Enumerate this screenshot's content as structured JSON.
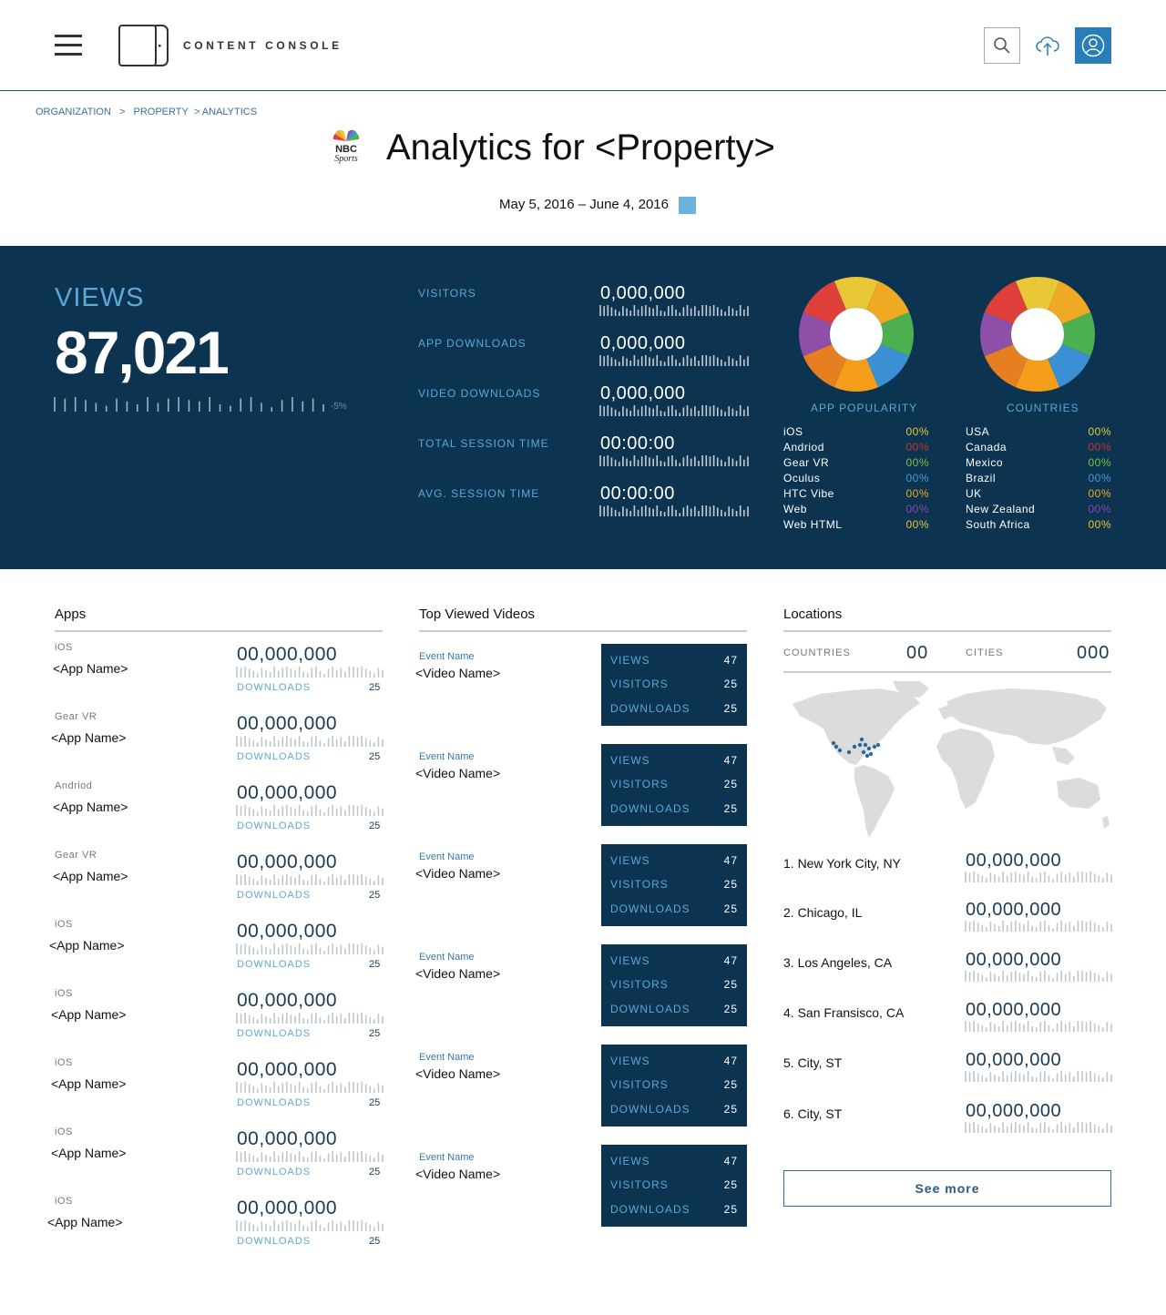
{
  "header": {
    "brand": "CONTENT CONSOLE"
  },
  "breadcrumb": [
    "ORGANIZATION",
    ">",
    "PROPERTY",
    "> ANALYTICS"
  ],
  "page": {
    "logo_text": "NBC Sports",
    "title": "Analytics for <Property>",
    "date_range": "May 5, 2016 – June 4, 2016"
  },
  "colors": {
    "panel": "#0c3350",
    "accent": "#5da8d6",
    "button": "#2a7eb8"
  },
  "views": {
    "label": "VIEWS",
    "value": "87,021",
    "change": "-5%"
  },
  "metrics": [
    {
      "label": "VISITORS",
      "value": "0,000,000"
    },
    {
      "label": "APP DOWNLOADS",
      "value": "0,000,000"
    },
    {
      "label": "VIDEO DOWNLOADS",
      "value": "0,000,000"
    },
    {
      "label": "TOTAL SESSION TIME",
      "value": "00:00:00"
    },
    {
      "label": "AVG. SESSION TIME",
      "value": "00:00:00"
    }
  ],
  "donut_colors": [
    "#e8c837",
    "#f0a922",
    "#4caf50",
    "#3b8fd3",
    "#f59e1c",
    "#e67e22",
    "#8e4fa8",
    "#e0403b"
  ],
  "app_popularity": {
    "title": "APP POPULARITY",
    "rows": [
      {
        "name": "iOS",
        "pct": "00%",
        "color": "#e8c837"
      },
      {
        "name": "Andriod",
        "pct": "00%",
        "color": "#c0392b"
      },
      {
        "name": "Gear VR",
        "pct": "00%",
        "color": "#7cc242"
      },
      {
        "name": "Oculus",
        "pct": "00%",
        "color": "#4a9ad8"
      },
      {
        "name": "HTC Vibe",
        "pct": "00%",
        "color": "#f0a922"
      },
      {
        "name": "Web",
        "pct": "00%",
        "color": "#8e44ad"
      },
      {
        "name": "Web HTML",
        "pct": "00%",
        "color": "#e8c837"
      }
    ]
  },
  "countries": {
    "title": "COUNTRIES",
    "rows": [
      {
        "name": "USA",
        "pct": "00%",
        "color": "#e8c837"
      },
      {
        "name": "Canada",
        "pct": "00%",
        "color": "#c0392b"
      },
      {
        "name": "Mexico",
        "pct": "00%",
        "color": "#7cc242"
      },
      {
        "name": "Brazil",
        "pct": "00%",
        "color": "#4a9ad8"
      },
      {
        "name": "UK",
        "pct": "00%",
        "color": "#f0a922"
      },
      {
        "name": "New Zealand",
        "pct": "00%",
        "color": "#8e44ad"
      },
      {
        "name": "South Africa",
        "pct": "00%",
        "color": "#e8c837"
      }
    ]
  },
  "apps": {
    "title": "Apps",
    "downloads_label": "DOWNLOADS",
    "items": [
      {
        "platform": "iOS",
        "name": "<App Name>",
        "value": "00,000,000",
        "downloads": "25"
      },
      {
        "platform": "Gear VR",
        "name": "<App Name>",
        "value": "00,000,000",
        "downloads": "25"
      },
      {
        "platform": "Andriod",
        "name": "<App Name>",
        "value": "00,000,000",
        "downloads": "25"
      },
      {
        "platform": "Gear VR",
        "name": "<App Name>",
        "value": "00,000,000",
        "downloads": "25"
      },
      {
        "platform": "iOS",
        "name": "<App Name>",
        "value": "00,000,000",
        "downloads": "25"
      },
      {
        "platform": "iOS",
        "name": "<App Name>",
        "value": "00,000,000",
        "downloads": "25"
      },
      {
        "platform": "iOS",
        "name": "<App Name>",
        "value": "00,000,000",
        "downloads": "25"
      },
      {
        "platform": "iOS",
        "name": "<App Name>",
        "value": "00,000,000",
        "downloads": "25"
      },
      {
        "platform": "iOS",
        "name": "<App Name>",
        "value": "00,000,000",
        "downloads": "25"
      }
    ]
  },
  "videos": {
    "title": "Top Viewed Videos",
    "stat_labels": {
      "views": "VIEWS",
      "visitors": "VISITORS",
      "downloads": "DOWNLOADS"
    },
    "items": [
      {
        "event": "Event Name",
        "name": "<Video Name>",
        "views": "47",
        "visitors": "25",
        "downloads": "25"
      },
      {
        "event": "Event Name",
        "name": "<Video Name>",
        "views": "47",
        "visitors": "25",
        "downloads": "25"
      },
      {
        "event": "Event Name",
        "name": "<Video Name>",
        "views": "47",
        "visitors": "25",
        "downloads": "25"
      },
      {
        "event": "Event Name",
        "name": "<Video Name>",
        "views": "47",
        "visitors": "25",
        "downloads": "25"
      },
      {
        "event": "Event Name",
        "name": "<Video Name>",
        "views": "47",
        "visitors": "25",
        "downloads": "25"
      },
      {
        "event": "Event Name",
        "name": "<Video Name>",
        "views": "47",
        "visitors": "25",
        "downloads": "25"
      }
    ]
  },
  "locations": {
    "title": "Locations",
    "countries_label": "COUNTRIES",
    "countries_value": "00",
    "cities_label": "CITIES",
    "cities_value": "000",
    "cities": [
      {
        "name": "1. New York City, NY",
        "value": "00,000,000"
      },
      {
        "name": "2. Chicago, IL",
        "value": "00,000,000"
      },
      {
        "name": "3. Los Angeles, CA",
        "value": "00,000,000"
      },
      {
        "name": "4. San Fransisco, CA",
        "value": "00,000,000"
      },
      {
        "name": "5. City, ST",
        "value": "00,000,000"
      },
      {
        "name": "6. City, ST",
        "value": "00,000,000"
      }
    ],
    "see_more": "See more"
  }
}
